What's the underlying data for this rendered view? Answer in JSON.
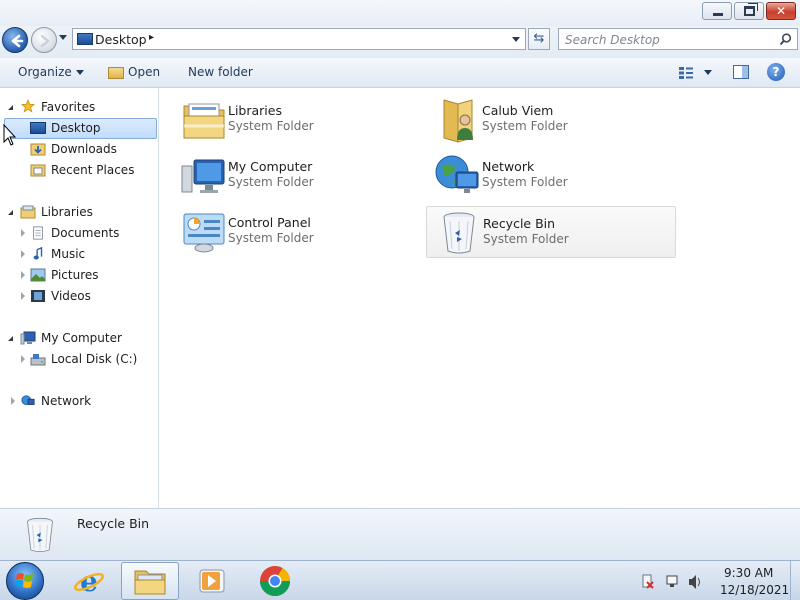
{
  "window": {
    "controls": {
      "minimize": "minimize",
      "maximize": "restore",
      "close": "close"
    }
  },
  "address": {
    "location": "Desktop",
    "separator": "▸",
    "search_placeholder": "Search Desktop"
  },
  "commandbar": {
    "organize": "Organize",
    "open": "Open",
    "new_folder": "New folder"
  },
  "navpane": {
    "favorites": {
      "label": "Favorites",
      "items": [
        {
          "label": "Desktop",
          "selected": true
        },
        {
          "label": "Downloads"
        },
        {
          "label": "Recent Places"
        }
      ]
    },
    "libraries": {
      "label": "Libraries",
      "items": [
        {
          "label": "Documents"
        },
        {
          "label": "Music"
        },
        {
          "label": "Pictures"
        },
        {
          "label": "Videos"
        }
      ]
    },
    "computer": {
      "label": "My Computer",
      "items": [
        {
          "label": "Local Disk (C:)"
        }
      ]
    },
    "network": {
      "label": "Network"
    }
  },
  "content": {
    "items": [
      {
        "name": "Libraries",
        "type": "System Folder",
        "icon": "libraries-icon"
      },
      {
        "name": "Calub Viem",
        "type": "System Folder",
        "icon": "user-folder-icon"
      },
      {
        "name": "My Computer",
        "type": "System Folder",
        "icon": "computer-icon"
      },
      {
        "name": "Network",
        "type": "System Folder",
        "icon": "network-icon"
      },
      {
        "name": "Control Panel",
        "type": "System Folder",
        "icon": "control-panel-icon"
      },
      {
        "name": "Recycle Bin",
        "type": "System Folder",
        "icon": "recycle-bin-icon"
      }
    ]
  },
  "details": {
    "name": "Recycle Bin"
  },
  "taskbar": {
    "items": [
      "start-orb",
      "internet-explorer",
      "windows-explorer",
      "media-player",
      "chrome"
    ],
    "clock": {
      "time": "9:30 AM",
      "date": "12/18/2021"
    }
  },
  "colors": {
    "selection": "#c1dcfc",
    "accent": "#2a62b3"
  }
}
